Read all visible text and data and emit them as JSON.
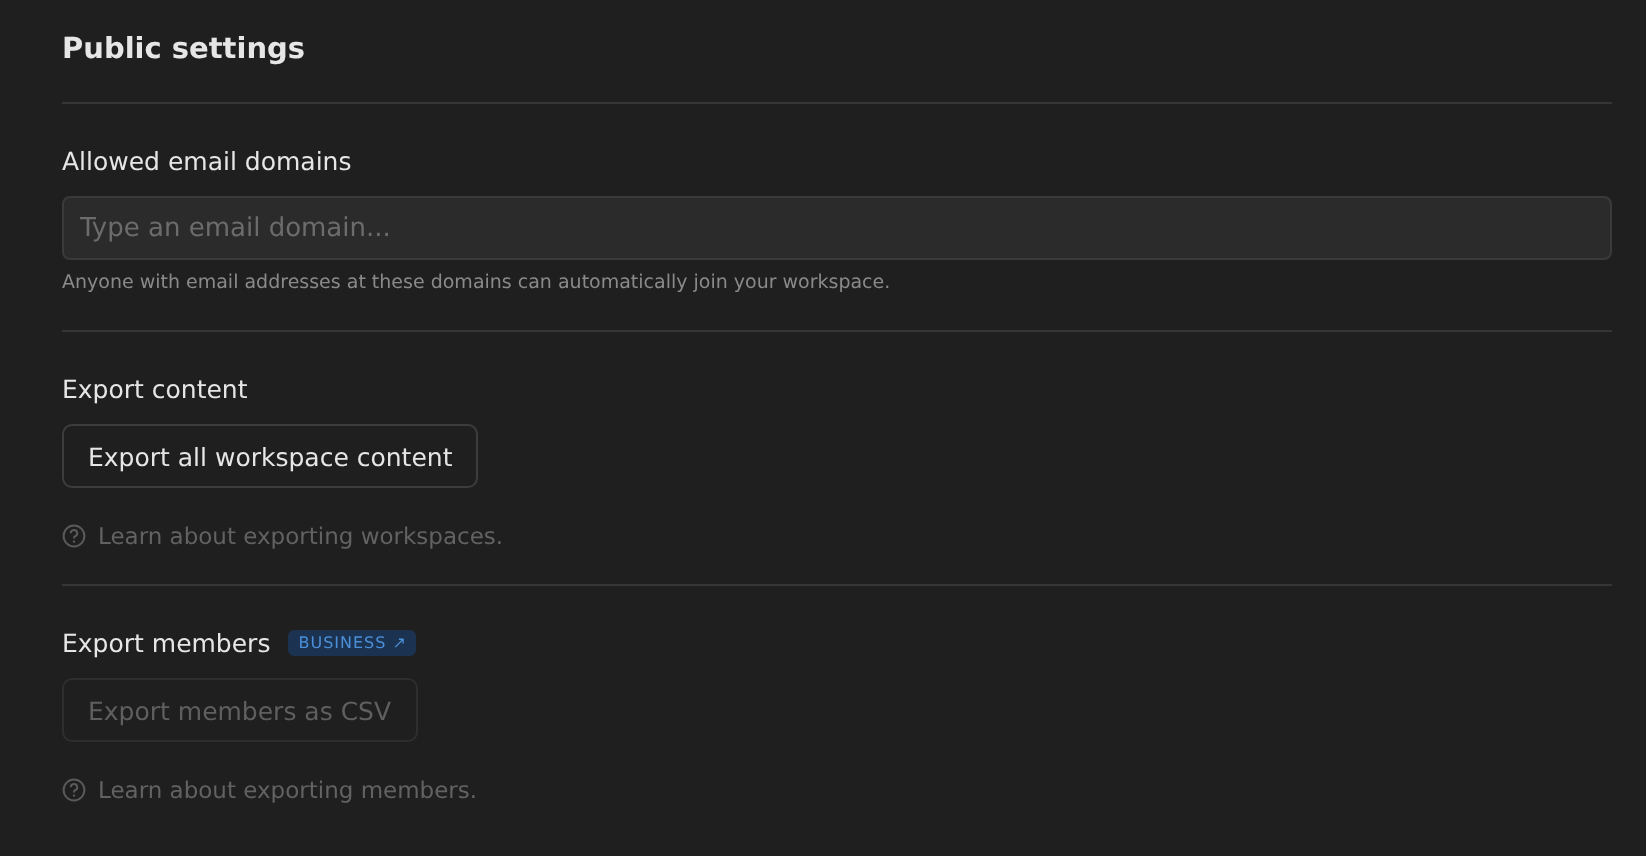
{
  "title": "Public settings",
  "sections": [
    {
      "kind": "field",
      "label": "Allowed email domains",
      "placeholder": "Type an email domain...",
      "help": "Anyone with email addresses at these domains can automatically join your workspace."
    },
    {
      "kind": "export",
      "label": "Export content",
      "button": {
        "label": "Export all workspace content",
        "disabled": false
      },
      "learn": "Learn about exporting workspaces."
    },
    {
      "kind": "export",
      "label": "Export members",
      "badge": "BUSINESS ↗",
      "button": {
        "label": "Export members as CSV",
        "disabled": true
      },
      "learn": "Learn about exporting members."
    }
  ]
}
